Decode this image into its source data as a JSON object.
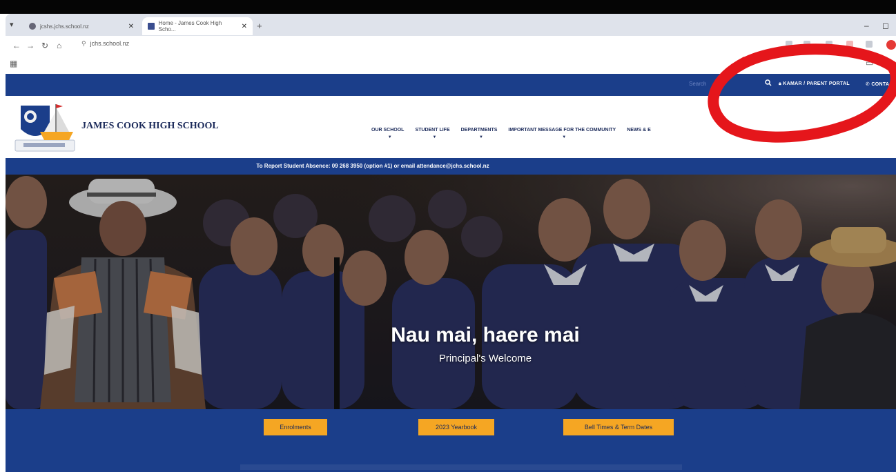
{
  "browser": {
    "tabs": [
      {
        "title": "jcshs.jchs.school.nz",
        "active": false
      },
      {
        "title": "Home - James Cook High Scho...",
        "active": true
      }
    ],
    "url": "jchs.school.nz",
    "icons": [
      "back-icon",
      "forward-icon",
      "reload-icon",
      "home-icon",
      "apps-icon"
    ]
  },
  "topbar": {
    "search_placeholder": "Search",
    "links": [
      {
        "label": "KAMAR / PARENT PORTAL",
        "icon": "lock-icon"
      },
      {
        "label": "CONTA",
        "icon": "phone-icon"
      }
    ]
  },
  "header": {
    "school_name": "JAMES COOK HIGH SCHOOL",
    "nav": [
      {
        "label": "OUR SCHOOL"
      },
      {
        "label": "STUDENT LIFE"
      },
      {
        "label": "DEPARTMENTS"
      },
      {
        "label": "IMPORTANT MESSAGE FOR THE COMMUNITY"
      },
      {
        "label": "NEWS & E"
      }
    ]
  },
  "absence_banner": "To Report Student Absence: 09 268 3950 (option #1) or email attendance@jchs.school.nz",
  "hero": {
    "title": "Nau mai, haere mai",
    "subtitle": "Principal's Welcome"
  },
  "quick_links": [
    "Enrolments",
    "2023 Yearbook",
    "Bell Times & Term Dates"
  ],
  "colors": {
    "brand_navy": "#1b3e8a",
    "accent_orange": "#f5a623",
    "annotation_red": "#e5161b"
  }
}
